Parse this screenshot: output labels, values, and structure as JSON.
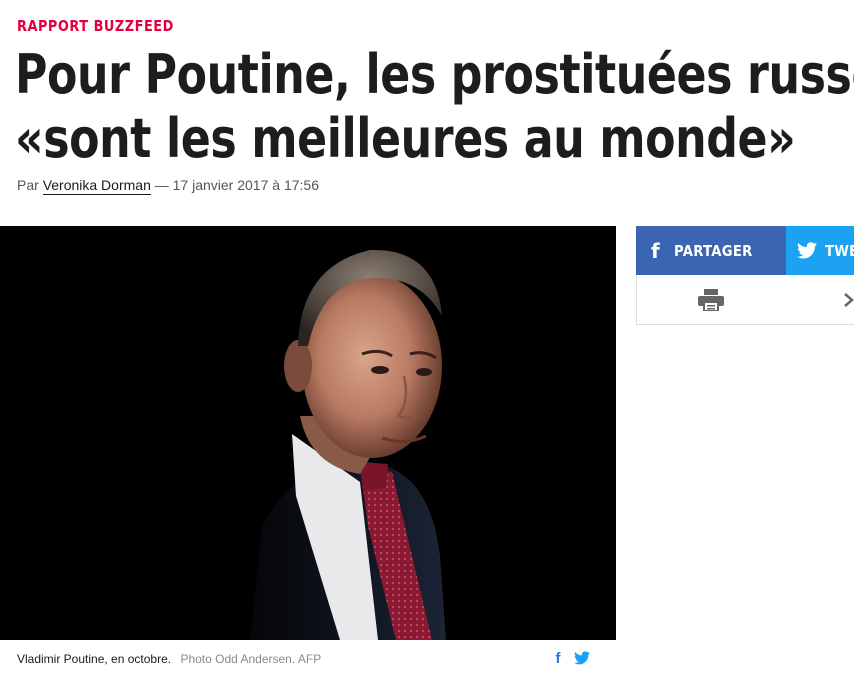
{
  "article": {
    "kicker": "RAPPORT BUZZFEED",
    "headline_line1": "Pour Poutine, les prostituées russes",
    "headline_line2": "«sont les meilleures au monde»",
    "byline_prefix": "Par",
    "author": "Veronika Dorman",
    "byline_suffix": "— 17 janvier 2017 à 17:56"
  },
  "photo": {
    "caption": "Vladimir Poutine, en octobre.",
    "credit": "Photo Odd Andersen. AFP"
  },
  "share": {
    "facebook_label": "PARTAGER",
    "twitter_label": "TWE",
    "facebook_color": "#3b65b0",
    "twitter_color": "#1da1f2",
    "icons": [
      "facebook-icon",
      "twitter-icon",
      "print-icon",
      "next-icon"
    ]
  }
}
